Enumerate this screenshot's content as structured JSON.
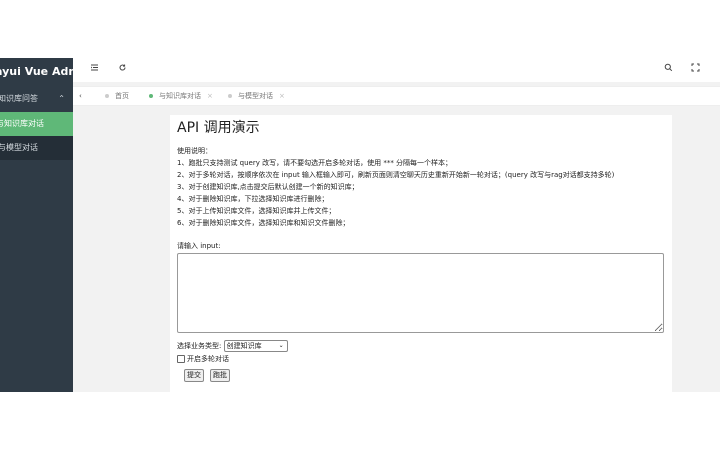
{
  "sidebar": {
    "brand": "Layui Vue Admin",
    "group": {
      "label": "知识库问答"
    },
    "items": [
      {
        "label": "与知识库对话",
        "active": true
      },
      {
        "label": "与模型对话",
        "active": false
      }
    ]
  },
  "topbar": {
    "icons": [
      "menu-fold-icon",
      "refresh-icon",
      "search-icon",
      "fullscreen-icon"
    ]
  },
  "tabs": [
    {
      "label": "首页",
      "active": false,
      "closable": false
    },
    {
      "label": "与知识库对话",
      "active": true,
      "closable": true
    },
    {
      "label": "与模型对话",
      "active": false,
      "closable": true
    }
  ],
  "content": {
    "title": "API 调用演示",
    "instructions": [
      "使用说明：",
      "1、跑批只支持测试 query 改写，请不要勾选开启多轮对话，使用 *** 分隔每一个样本；",
      "2、对于多轮对话，按顺序依次在 input 输入框输入即可，刷新页面则清空聊天历史重新开始新一轮对话；(query 改写与rag对话都支持多轮)",
      "3、对于创建知识库,点击提交后默认创建一个新的知识库；",
      "4、对于删除知识库，下拉选择知识库进行删除；",
      "5、对于上传知识库文件，选择知识库并上传文件；",
      "6、对于删除知识库文件，选择知识库和知识文件删除；"
    ],
    "input_label": "请输入 input:",
    "textarea_value": "",
    "business_label": "选择业务类型:",
    "business_selected": "创建知识库",
    "multi_turn_label": "开启多轮对话",
    "multi_turn_checked": false,
    "submit_label": "提交",
    "batch_label": "跑批"
  }
}
